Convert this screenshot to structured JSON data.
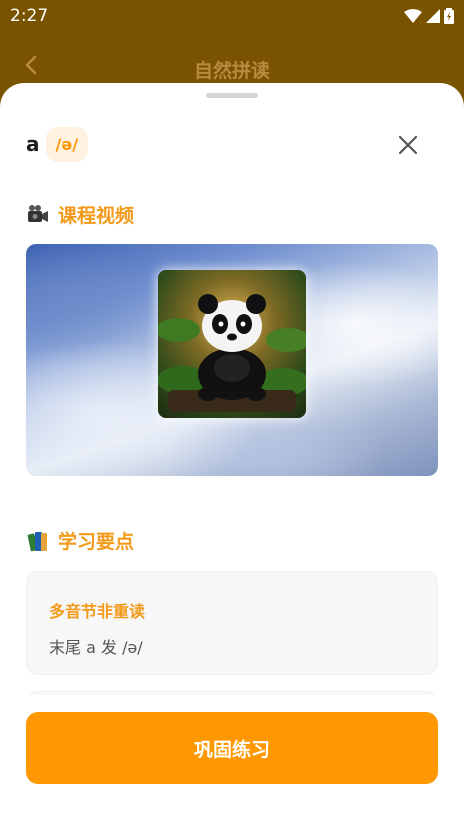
{
  "status_bar": {
    "time": "2:27"
  },
  "header": {
    "title": "自然拼读"
  },
  "sheet": {
    "letter": "a",
    "phonetic": "/ə/",
    "video_section": {
      "title": "课程视频",
      "icon": "video-camera-icon"
    },
    "points_section": {
      "title": "学习要点",
      "icon": "books-icon",
      "cards": [
        {
          "title": "多音节非重读",
          "desc": "末尾 a 发 /ə/"
        }
      ]
    },
    "practice_button": "巩固练习"
  },
  "colors": {
    "accent": "#ff9800",
    "section_title": "#f29a1a",
    "pill_bg": "#fff2e0",
    "header_bg": "#7a5300"
  }
}
